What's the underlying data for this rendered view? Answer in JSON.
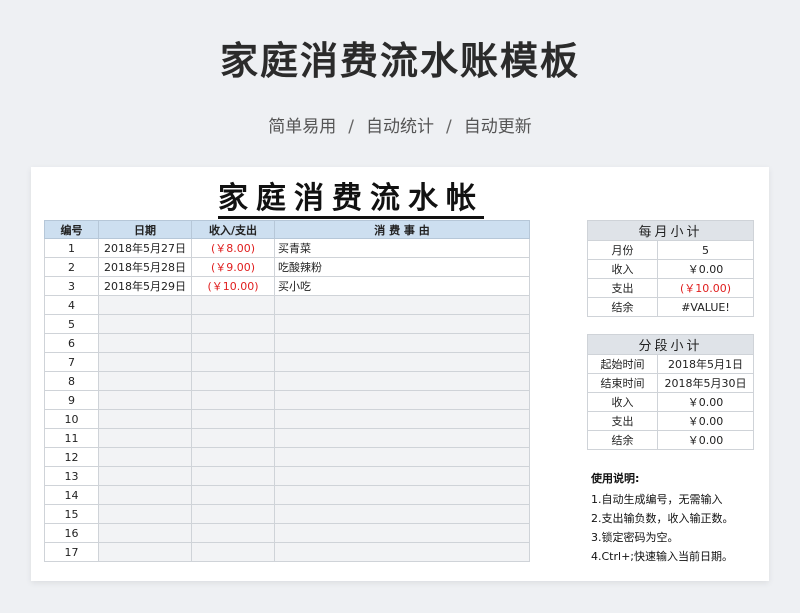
{
  "hero": {
    "title": "家庭消费流水账模板",
    "features": [
      "简单易用",
      "自动统计",
      "自动更新"
    ],
    "separator": "/"
  },
  "sheet": {
    "title": "家庭消费流水帐",
    "headers": [
      "编号",
      "日期",
      "收入/支出",
      "消 费 事 由"
    ],
    "rows": [
      {
        "no": "1",
        "date": "2018年5月27日",
        "amount": "(￥8.00)",
        "desc": "买青菜"
      },
      {
        "no": "2",
        "date": "2018年5月28日",
        "amount": "(￥9.00)",
        "desc": "吃酸辣粉"
      },
      {
        "no": "3",
        "date": "2018年5月29日",
        "amount": "(￥10.00)",
        "desc": "买小吃"
      },
      {
        "no": "4"
      },
      {
        "no": "5"
      },
      {
        "no": "6"
      },
      {
        "no": "7"
      },
      {
        "no": "8"
      },
      {
        "no": "9"
      },
      {
        "no": "10"
      },
      {
        "no": "11"
      },
      {
        "no": "12"
      },
      {
        "no": "13"
      },
      {
        "no": "14"
      },
      {
        "no": "15"
      },
      {
        "no": "16"
      },
      {
        "no": "17"
      }
    ]
  },
  "monthly": {
    "title": "每月小计",
    "rows": [
      {
        "label": "月份",
        "value": "5"
      },
      {
        "label": "收入",
        "value": "￥0.00"
      },
      {
        "label": "支出",
        "value": "(￥10.00)"
      },
      {
        "label": "结余",
        "value": "#VALUE!"
      }
    ]
  },
  "segment": {
    "title": "分段小计",
    "rows": [
      {
        "label": "起始时间",
        "value": "2018年5月1日"
      },
      {
        "label": "结束时间",
        "value": "2018年5月30日"
      },
      {
        "label": "收入",
        "value": "￥0.00"
      },
      {
        "label": "支出",
        "value": "￥0.00"
      },
      {
        "label": "结余",
        "value": "￥0.00"
      }
    ]
  },
  "usage": {
    "title": "使用说明:",
    "items": [
      "1.自动生成编号，无需输入",
      "2.支出输负数，收入输正数。",
      "3.锁定密码为空。",
      "4.Ctrl+;快速输入当前日期。"
    ]
  },
  "colors": {
    "header_blue": "#cddff0",
    "negative_red": "#e02020",
    "summary_header": "#dfe3e8"
  }
}
